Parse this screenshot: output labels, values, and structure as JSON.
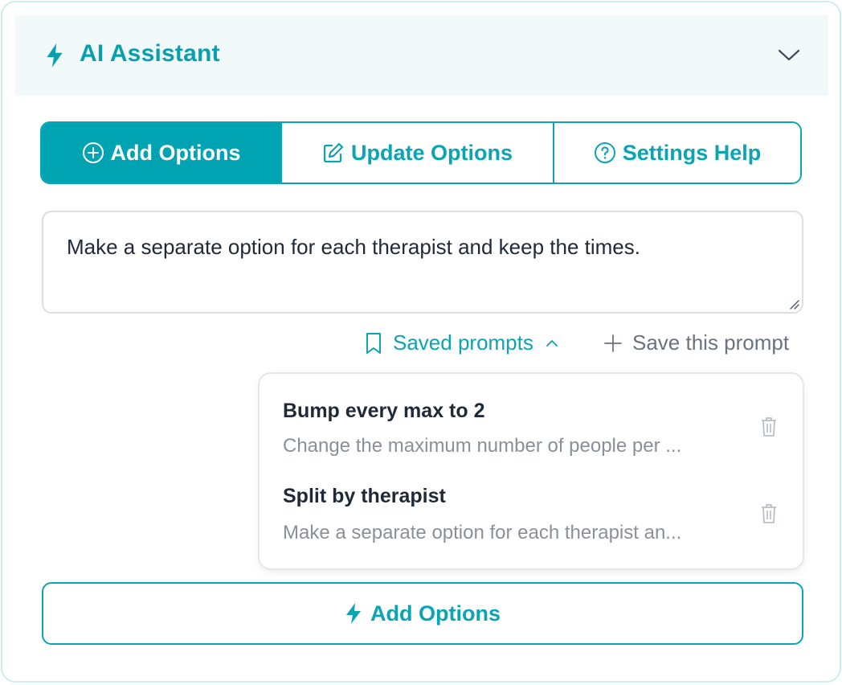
{
  "header": {
    "title": "AI Assistant",
    "icon": "bolt-icon",
    "toggle_icon": "chevron-down-icon"
  },
  "tabs": [
    {
      "label": "Add Options",
      "icon": "plus-circle-icon",
      "active": true
    },
    {
      "label": "Update Options",
      "icon": "edit-icon",
      "active": false
    },
    {
      "label": "Settings Help",
      "icon": "question-circle-icon",
      "active": false
    }
  ],
  "prompt": {
    "value": "Make a separate option for each therapist and keep the times."
  },
  "actions": {
    "saved_prompts_label": "Saved prompts",
    "save_prompt_label": "Save this prompt"
  },
  "saved_prompts": [
    {
      "name": "Bump every max to 2",
      "description": "Change the maximum number of people per ..."
    },
    {
      "name": "Split by therapist",
      "description": "Make a separate option for each therapist an..."
    }
  ],
  "submit": {
    "label": "Add Options"
  },
  "colors": {
    "accent": "#00a3b1",
    "header_bg": "#f1f9fb",
    "muted": "#8a9099"
  }
}
